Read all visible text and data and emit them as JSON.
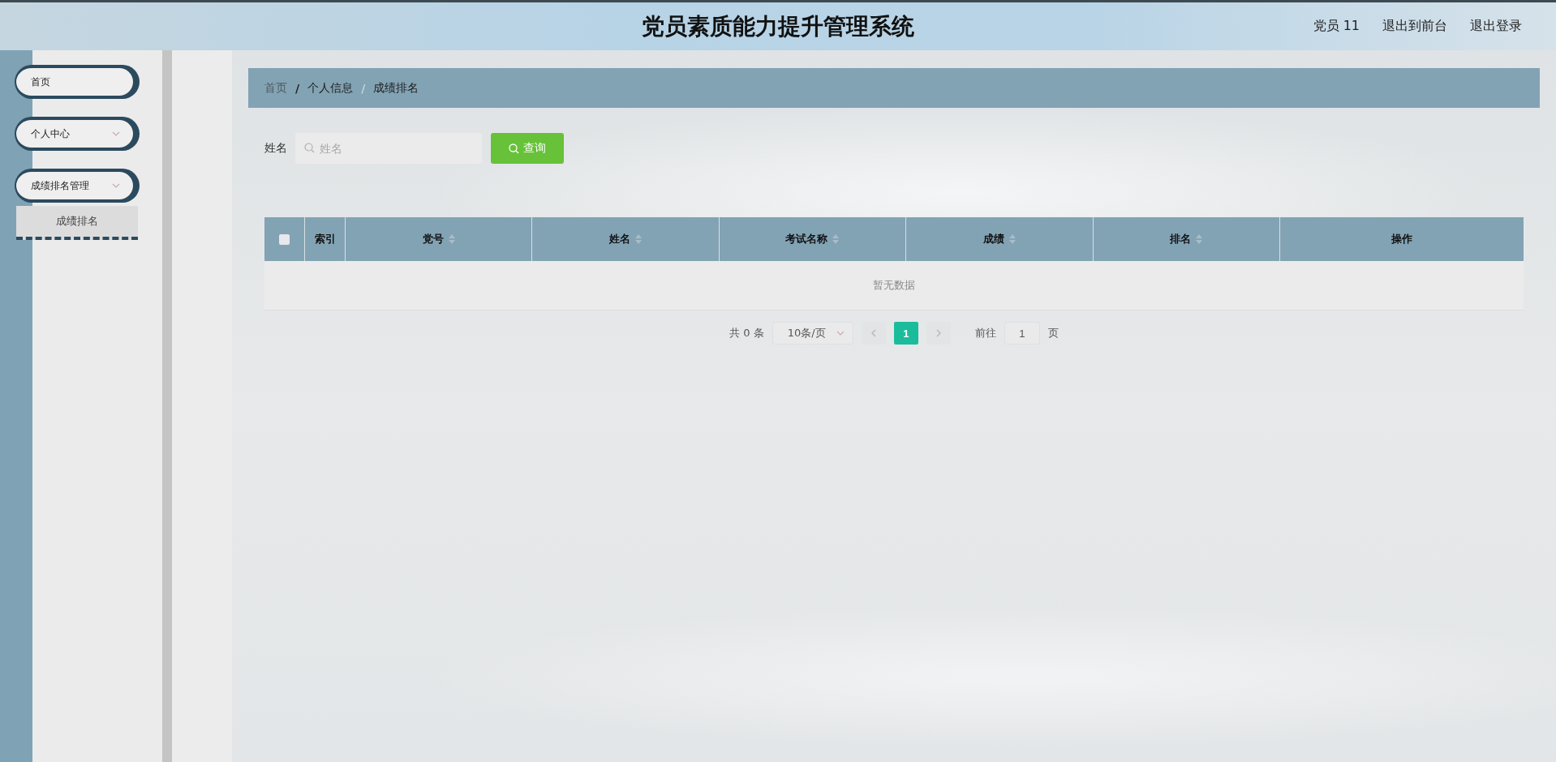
{
  "header": {
    "title": "党员素质能力提升管理系统",
    "links": [
      "党员 11",
      "退出到前台",
      "退出登录"
    ]
  },
  "sidebar": {
    "items": [
      {
        "label": "首页",
        "kind": "link"
      },
      {
        "label": "个人中心",
        "kind": "group"
      },
      {
        "label": "成绩排名管理",
        "kind": "group",
        "children": [
          {
            "label": "成绩排名",
            "selected": true
          }
        ]
      }
    ]
  },
  "breadcrumb": {
    "separator": "/",
    "items": [
      "首页",
      "个人信息",
      "成绩排名"
    ]
  },
  "search": {
    "label": "姓名",
    "placeholder": "姓名",
    "button": "查询"
  },
  "table": {
    "select_all": {
      "checked": false
    },
    "columns": [
      {
        "label": "索引",
        "sortable": false
      },
      {
        "label": "党号",
        "sortable": true
      },
      {
        "label": "姓名",
        "sortable": true
      },
      {
        "label": "考试名称",
        "sortable": true
      },
      {
        "label": "成绩",
        "sortable": true
      },
      {
        "label": "排名",
        "sortable": true
      },
      {
        "label": "操作",
        "sortable": false
      }
    ],
    "empty_text": "暂无数据"
  },
  "pagination": {
    "total": "共 0 条",
    "page_size": "10条/页",
    "pages": [
      {
        "label": "1",
        "selected": true
      }
    ],
    "goto_label": "前往",
    "goto_value": "1",
    "goto_suffix": "页"
  }
}
